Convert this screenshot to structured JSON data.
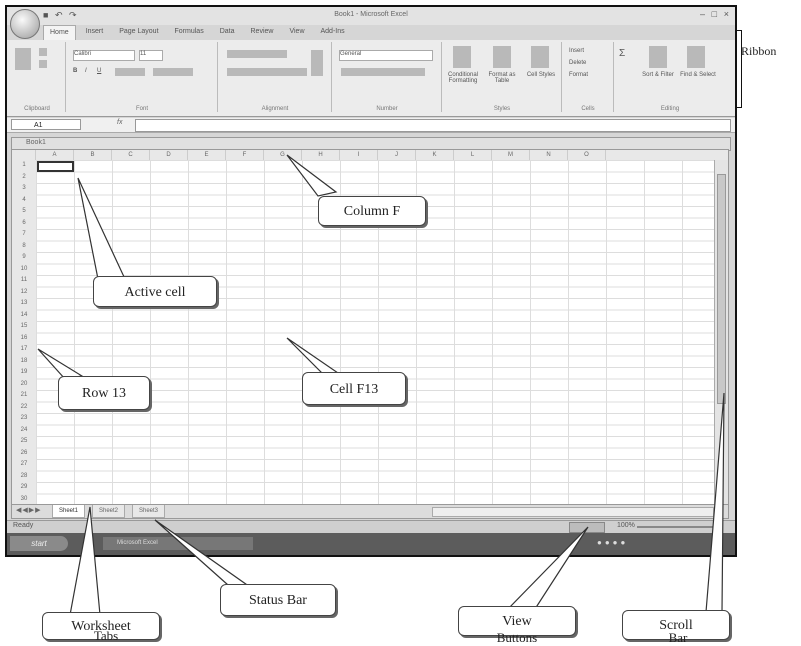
{
  "window": {
    "title": "Book1 - Microsoft Excel",
    "qat_icons": [
      "save-icon",
      "undo-icon",
      "redo-icon"
    ]
  },
  "ribbon": {
    "tabs": [
      "Home",
      "Insert",
      "Page Layout",
      "Formulas",
      "Data",
      "Review",
      "View",
      "Add-Ins"
    ],
    "groups": [
      "Clipboard",
      "Font",
      "Alignment",
      "Number",
      "Styles",
      "Cells",
      "Editing"
    ],
    "font_name": "Calibri",
    "font_size": "11",
    "number_format": "General",
    "styles_buttons": [
      "Conditional Formatting",
      "Format as Table",
      "Cell Styles"
    ],
    "cells_buttons": [
      "Insert",
      "Delete",
      "Format"
    ],
    "editing_buttons": [
      "Sort & Filter",
      "Find & Select"
    ]
  },
  "formula_bar": {
    "name_box": "A1",
    "fx_label": "fx"
  },
  "workbook": {
    "name": "Book1",
    "columns": [
      "A",
      "B",
      "C",
      "D",
      "E",
      "F",
      "G",
      "H",
      "I",
      "J",
      "K",
      "L",
      "M",
      "N",
      "O"
    ],
    "rows": [
      "1",
      "2",
      "3",
      "4",
      "5",
      "6",
      "7",
      "8",
      "9",
      "10",
      "11",
      "12",
      "13",
      "14",
      "15",
      "16",
      "17",
      "18",
      "19",
      "20",
      "21",
      "22",
      "23",
      "24",
      "25",
      "26",
      "27",
      "28",
      "29",
      "30"
    ]
  },
  "sheet_tabs": [
    "Sheet1",
    "Sheet2",
    "Sheet3"
  ],
  "status_bar": {
    "status": "Ready",
    "zoom": "100%"
  },
  "taskbar": {
    "start": "start",
    "task": "Microsoft Excel"
  },
  "annotations": {
    "ribbon": "Ribbon",
    "column_f": "Column F",
    "active_cell": "Active cell",
    "row_13": "Row 13",
    "cell_f13": "Cell F13",
    "worksheet_tabs_1": "Worksheet",
    "worksheet_tabs_2": "Tabs",
    "status_bar": "Status Bar",
    "view_buttons_1": "View",
    "view_buttons_2": "Buttons",
    "scroll_bar_1": "Scroll",
    "scroll_bar_2": "Bar"
  }
}
